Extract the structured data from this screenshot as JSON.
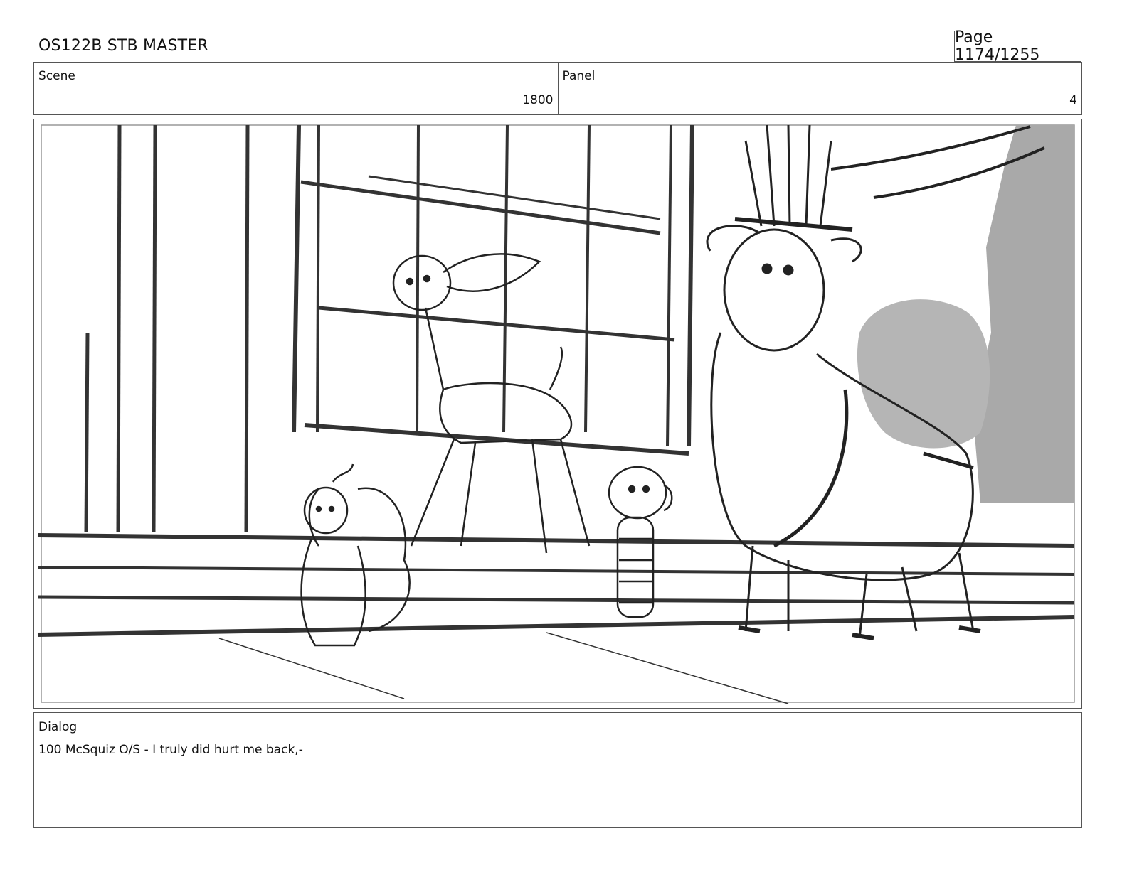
{
  "header": {
    "title": "OS122B STB MASTER",
    "page": "Page 1174/1255"
  },
  "scene": {
    "label": "Scene",
    "value": "1800"
  },
  "panel": {
    "label": "Panel",
    "value": "4"
  },
  "dialog": {
    "label": "Dialog",
    "text": "100 McSquiz O/S - I truly did hurt me back,-"
  },
  "colors": {
    "border": "#555555",
    "sketch": "#222222",
    "shade": "#a9a9a9"
  }
}
